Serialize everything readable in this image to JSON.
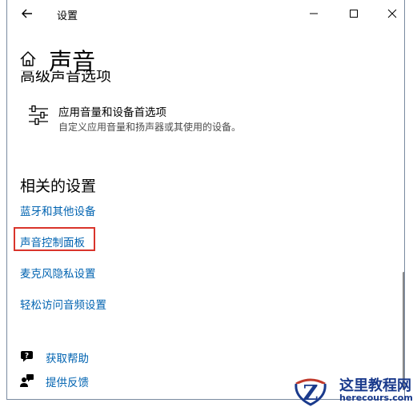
{
  "window": {
    "title": "设置"
  },
  "header": {
    "title": "声音"
  },
  "advanced": {
    "section_title": "高级声音选项",
    "app_option": {
      "title": "应用音量和设备首选项",
      "description": "自定义应用音量和扬声器或其使用的设备。"
    }
  },
  "related": {
    "title": "相关的设置",
    "links": [
      {
        "label": "蓝牙和其他设备"
      },
      {
        "label": "声音控制面板"
      },
      {
        "label": "麦克风隐私设置"
      },
      {
        "label": "轻松访问音频设置"
      }
    ]
  },
  "help": {
    "get_help": "获取帮助",
    "feedback": "提供反馈"
  },
  "watermark": {
    "title": "这里教程网",
    "url": "herecours.com"
  },
  "colors": {
    "link": "#0063b1",
    "highlight": "#d9342b",
    "watermark": "#1a3a8c"
  }
}
